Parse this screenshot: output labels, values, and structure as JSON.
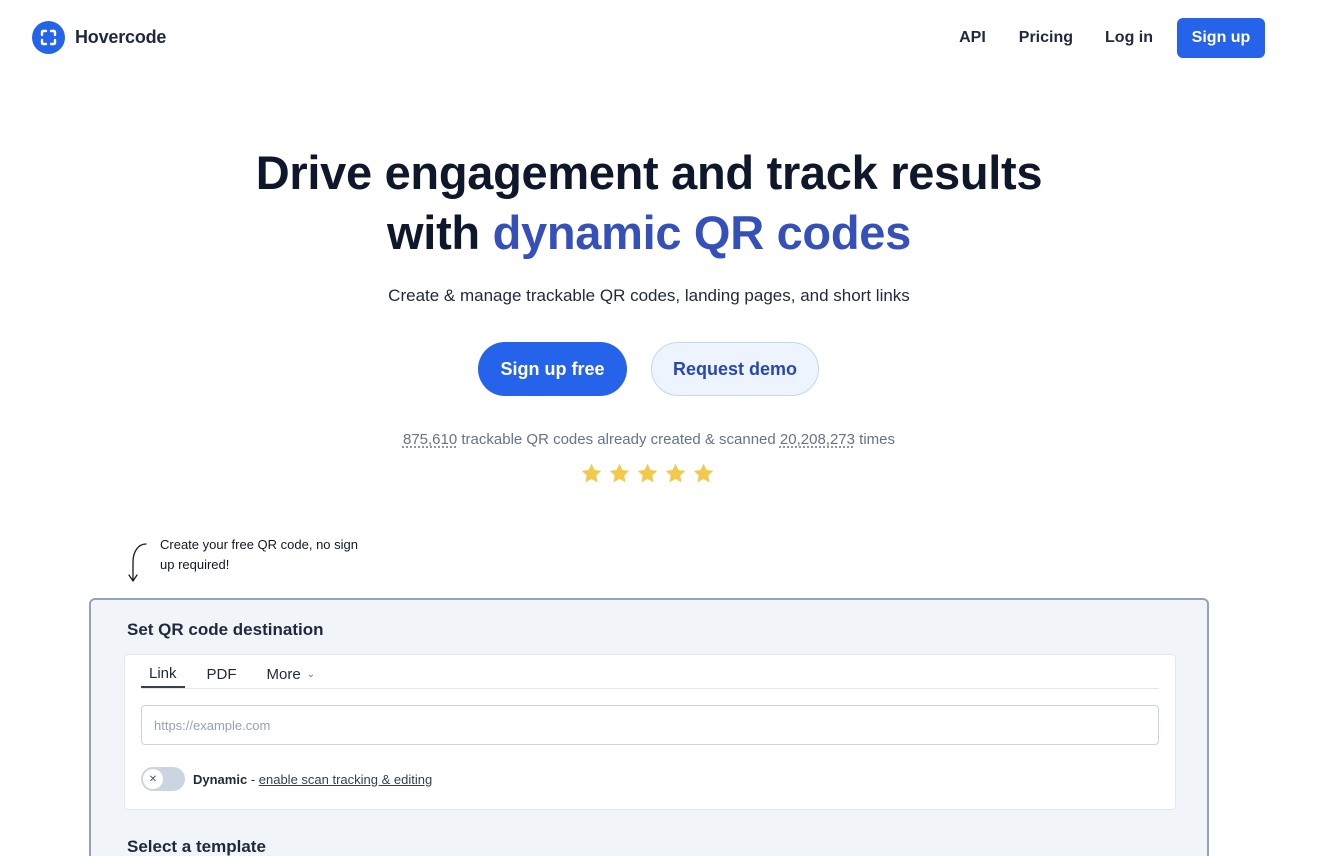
{
  "header": {
    "brand": "Hovercode",
    "nav": {
      "api": "API",
      "pricing": "Pricing",
      "login": "Log in",
      "signup": "Sign up"
    }
  },
  "hero": {
    "title_line1": "Drive engagement and track results",
    "title_line2_prefix": "with ",
    "title_line2_accent": "dynamic QR codes",
    "subtitle": "Create & manage trackable QR codes, landing pages, and short links",
    "cta_primary": "Sign up free",
    "cta_secondary": "Request demo",
    "stats": {
      "codes_count": "875,610",
      "middle_text": " trackable QR codes already created & scanned ",
      "scans_count": "20,208,273",
      "suffix": " times"
    },
    "rating_stars": 5
  },
  "callout": {
    "text": "Create your free QR code, no sign up required!"
  },
  "generator": {
    "title": "Set QR code destination",
    "tabs": [
      {
        "label": "Link",
        "active": true
      },
      {
        "label": "PDF",
        "active": false
      },
      {
        "label": "More",
        "active": false
      }
    ],
    "url_placeholder": "https://example.com",
    "url_value": "",
    "dynamic_label": "Dynamic",
    "dynamic_separator": " - ",
    "dynamic_link": "enable scan tracking & editing",
    "dynamic_enabled": false,
    "template_title": "Select a template"
  },
  "colors": {
    "brand_blue": "#2563eb",
    "accent_text": "#3550b8",
    "star": "#f3c94b"
  }
}
